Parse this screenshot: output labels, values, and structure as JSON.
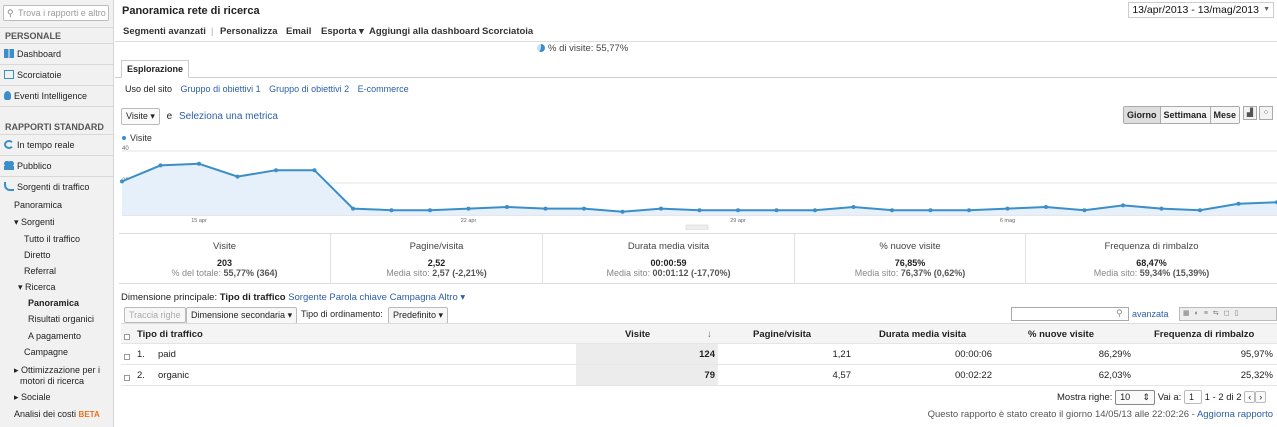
{
  "sidebar": {
    "search_placeholder": "Trova i rapporti e altro",
    "section_personal": "PERSONALE",
    "personal_items": [
      "Dashboard",
      "Scorciatoie",
      "Eventi Intelligence"
    ],
    "section_reports": "RAPPORTI STANDARD",
    "report_items": [
      "In tempo reale",
      "Pubblico",
      "Sorgenti di traffico"
    ],
    "traffic_sub": {
      "panoramica": "Panoramica",
      "sorgenti": "Sorgenti",
      "tutto": "Tutto il traffico",
      "diretto": "Diretto",
      "referral": "Referral",
      "ricerca": "Ricerca",
      "ricerca_panoramica": "Panoramica",
      "risultati": "Risultati organici",
      "pagamento": "A pagamento",
      "campagne": "Campagne",
      "ottimizzazione_1": "Ottimizzazione per i",
      "ottimizzazione_2": "motori di ricerca",
      "sociale": "Sociale",
      "analisi": "Analisi dei costi",
      "beta": "BETA"
    }
  },
  "header": {
    "title": "Panoramica rete di ricerca",
    "date_range": "13/apr/2013 - 13/mag/2013"
  },
  "toolbar": {
    "segments": "Segmenti avanzati",
    "customize": "Personalizza",
    "email": "Email",
    "export": "Esporta",
    "dashboard": "Aggiungi alla dashboard",
    "shortcut": "Scorciatoia"
  },
  "visits_pct": "% di visite: 55,77%",
  "tabs": {
    "explore": "Esplorazione",
    "subtabs": [
      "Uso del sito",
      "Gruppo di obiettivi 1",
      "Gruppo di obiettivi 2",
      "E-commerce"
    ]
  },
  "metric": {
    "selected": "Visite",
    "and": "e",
    "select_link": "Seleziona una metrica",
    "granularity": [
      "Giorno",
      "Settimana",
      "Mese"
    ],
    "active_granularity": "Giorno"
  },
  "chart_data": {
    "type": "line",
    "legend": "Visite",
    "y_ticks": [
      "40",
      "20"
    ],
    "ylim": [
      0,
      40
    ],
    "x_labels": [
      "15 apr",
      "22 apr",
      "29 apr",
      "6 mag"
    ],
    "x": [
      "13 apr",
      "14 apr",
      "15 apr",
      "16 apr",
      "17 apr",
      "18 apr",
      "19 apr",
      "20 apr",
      "21 apr",
      "22 apr",
      "23 apr",
      "24 apr",
      "25 apr",
      "26 apr",
      "27 apr",
      "28 apr",
      "29 apr",
      "30 apr",
      "1 mag",
      "2 mag",
      "3 mag",
      "4 mag",
      "5 mag",
      "6 mag",
      "7 mag",
      "8 mag",
      "9 mag",
      "10 mag",
      "11 mag",
      "12 mag",
      "13 mag"
    ],
    "series": [
      {
        "name": "Visite",
        "color": "#3b8ec7",
        "values": [
          21,
          31,
          32,
          24,
          28,
          28,
          4,
          3,
          3,
          4,
          5,
          4,
          4,
          2,
          4,
          3,
          3,
          3,
          3,
          5,
          3,
          3,
          3,
          4,
          5,
          3,
          6,
          4,
          3,
          7,
          8
        ]
      }
    ],
    "grid": true
  },
  "summary": [
    {
      "label": "Visite",
      "value": "203",
      "sub_label": "% del totale:",
      "sub_value": "55,77% (364)"
    },
    {
      "label": "Pagine/visita",
      "value": "2,52",
      "sub_label": "Media sito:",
      "sub_value": "2,57 (-2,21%)"
    },
    {
      "label": "Durata media visita",
      "value": "00:00:59",
      "sub_label": "Media sito:",
      "sub_value": "00:01:12 (-17,70%)"
    },
    {
      "label": "% nuove visite",
      "value": "76,85%",
      "sub_label": "Media sito:",
      "sub_value": "76,37% (0,62%)"
    },
    {
      "label": "Frequenza di rimbalzo",
      "value": "68,47%",
      "sub_label": "Media sito:",
      "sub_value": "59,34% (15,39%)"
    }
  ],
  "dimension": {
    "label": "Dimensione principale:",
    "active": "Tipo di traffico",
    "options": [
      "Sorgente",
      "Parola chiave",
      "Campagna",
      "Altro"
    ]
  },
  "table_controls": {
    "plot_rows": "Traccia righe",
    "secondary_dim": "Dimensione secondaria",
    "sort_label": "Tipo di ordinamento:",
    "sort_value": "Predefinito",
    "advanced": "avanzata"
  },
  "table": {
    "columns": [
      "Tipo di traffico",
      "Visite",
      "Pagine/visita",
      "Durata media visita",
      "% nuove visite",
      "Frequenza di rimbalzo"
    ],
    "rows": [
      {
        "index": "1.",
        "name": "paid",
        "visits": "124",
        "pages": "1,21",
        "duration": "00:00:06",
        "new": "86,29%",
        "bounce": "95,97%"
      },
      {
        "index": "2.",
        "name": "organic",
        "visits": "79",
        "pages": "4,57",
        "duration": "00:02:22",
        "new": "62,03%",
        "bounce": "25,32%"
      }
    ]
  },
  "pager": {
    "show_rows": "Mostra righe:",
    "rows_value": "10",
    "goto": "Vai a:",
    "goto_value": "1",
    "range": "1 - 2 di 2"
  },
  "footer": {
    "created": "Questo rapporto è stato creato il giorno 14/05/13 alle 22:02:26 -",
    "refresh": "Aggiorna rapporto"
  }
}
